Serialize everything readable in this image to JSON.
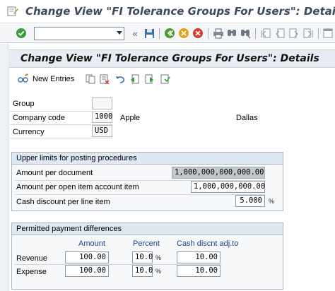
{
  "window": {
    "title": "Change View \"FI Tolerance Groups For Users\": Details"
  },
  "toolbar": {
    "command_value": "",
    "icons": [
      "enter-icon",
      "back-icon",
      "save-icon",
      "exit-icon",
      "cancel-icon",
      "print-icon",
      "find-icon",
      "find-next-icon",
      "first-page-icon",
      "previous-page-icon",
      "next-page-icon",
      "last-page-icon",
      "new-session-icon"
    ]
  },
  "header": {
    "title": "Change View \"FI Tolerance Groups For Users\": Details"
  },
  "app_toolbar": {
    "new_entries_label": "New Entries"
  },
  "fields": {
    "group_label": "Group",
    "group_value": "",
    "company_code_label": "Company code",
    "company_code_value": "1000",
    "company_name": "Apple",
    "company_city": "Dallas",
    "currency_label": "Currency",
    "currency_value": "USD"
  },
  "upper_limits": {
    "title": "Upper limits for posting procedures",
    "rows": [
      {
        "label": "Amount per document",
        "value": "1,000,000,000,000.00"
      },
      {
        "label": "Amount per open item account item",
        "value": "1,000,000,000.00"
      },
      {
        "label": "Cash discount per line item",
        "value": "5.000",
        "unit": "%"
      }
    ]
  },
  "payment_diffs": {
    "title": "Permitted payment differences",
    "col_amount": "Amount",
    "col_percent": "Percent",
    "col_cash": "Cash discnt adj.to",
    "percent_unit": "%",
    "rows": [
      {
        "label": "Revenue",
        "amount": "100.00",
        "percent": "10.0",
        "cash": "10.00"
      },
      {
        "label": "Expense",
        "amount": "100.00",
        "percent": "10.0",
        "cash": "10.00"
      }
    ]
  }
}
